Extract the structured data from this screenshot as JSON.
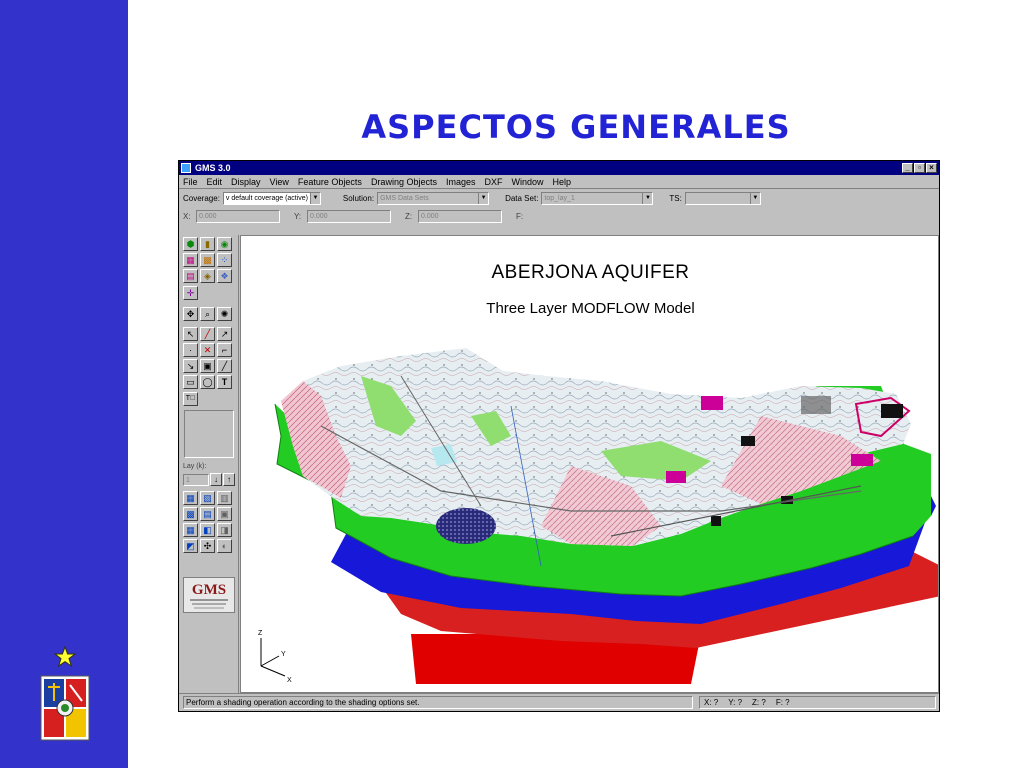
{
  "slide": {
    "title": "ASPECTOS GENERALES",
    "colors": {
      "sidebar": "#3333cc",
      "title": "#2323d6"
    }
  },
  "window": {
    "title": "GMS 3.0",
    "controls": [
      "_",
      "▫",
      "×"
    ],
    "menu": [
      "File",
      "Edit",
      "Display",
      "View",
      "Feature Objects",
      "Drawing Objects",
      "Images",
      "DXF",
      "Window",
      "Help"
    ],
    "toolbar": {
      "coverage_label": "Coverage:",
      "coverage_value": "v default coverage (active)",
      "solution_label": "Solution:",
      "solution_value": "GMS Data Sets",
      "dataset_label": "Data Set:",
      "dataset_value": "top_lay_1",
      "ts_label": "TS:",
      "ts_value": "",
      "x_label": "X:",
      "x_value": "0.000",
      "y_label": "Y:",
      "y_value": "0.000",
      "z_label": "Z:",
      "z_value": "0.000",
      "f_label": "F:"
    },
    "toolbox": {
      "lay_label": "Lay (k):",
      "lay_value": "1",
      "logo_text": "GMS"
    },
    "viewport": {
      "title": "ABERJONA AQUIFER",
      "subtitle": "Three Layer MODFLOW Model",
      "axis": {
        "z": "Z",
        "y": "Y",
        "x": "X"
      }
    },
    "status": {
      "message": "Perform a shading operation according to the shading options set.",
      "x": "X: ?",
      "y": "Y: ?",
      "z": "Z: ?",
      "f": "F: ?"
    }
  }
}
